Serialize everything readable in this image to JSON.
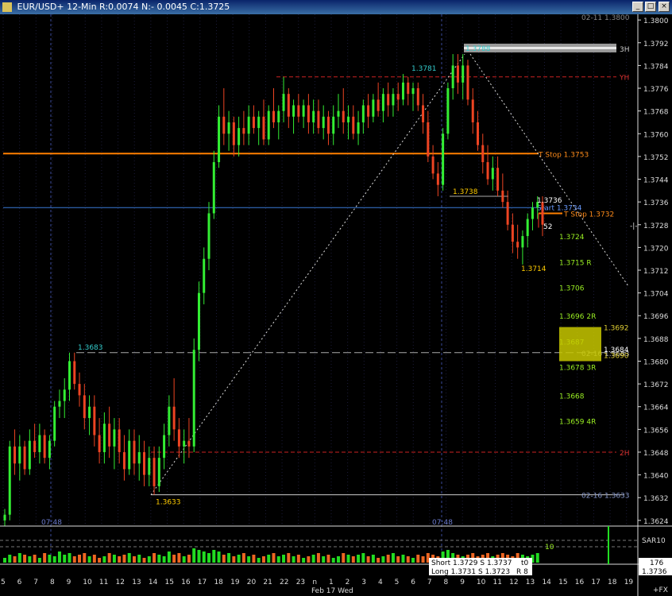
{
  "window": {
    "title": "EUR/USD+ 12-Min R:0.0074 N:- 0.0045 C:1.3725"
  },
  "chart_data": {
    "type": "candlestick",
    "symbol": "EUR/USD+",
    "interval": "12-Min",
    "header_stats": {
      "R": "0.0074",
      "N": "- 0.0045",
      "C": "1.3725"
    },
    "ylim": [
      1.3622,
      1.3802
    ],
    "y_ticks": [
      "1.3800",
      "1.3792",
      "1.3784",
      "1.3776",
      "1.3768",
      "1.3760",
      "1.3752",
      "1.3744",
      "1.3736",
      "1.3728",
      "1.3720",
      "1.3712",
      "1.3704",
      "1.3696",
      "1.3688",
      "1.3680",
      "1.3672",
      "1.3664",
      "1.3656",
      "1.3648",
      "1.3640",
      "1.3632",
      "1.3624"
    ],
    "x_ticks": [
      "5",
      "6",
      "7",
      "8",
      "9",
      "10",
      "11",
      "12",
      "13",
      "14",
      "15",
      "16",
      "17",
      "18",
      "19",
      "20",
      "21",
      "22",
      "23",
      "n",
      "1",
      "2",
      "3",
      "4",
      "5",
      "6",
      "7",
      "8",
      "9",
      "10",
      "11",
      "12",
      "13",
      "14",
      "15",
      "16",
      "17",
      "18",
      "19"
    ],
    "x_label": "Feb 17 Wed",
    "session_labels": [
      "07:48",
      "07:48"
    ],
    "top_right_label": "02-11  1.3800",
    "levels": [
      {
        "name": "3H",
        "price": 1.379,
        "color": "#bbbbbb",
        "text": "3H"
      },
      {
        "name": "YH",
        "price": 1.378,
        "color": "#cc2222",
        "text": "YH"
      },
      {
        "name": "T Stop",
        "price": 1.3753,
        "color": "#ff8000",
        "text": "T Stop  1.3753"
      },
      {
        "name": "Start",
        "price": 1.3734,
        "color": "#3a7bd5",
        "text": "Start  1.3734"
      },
      {
        "name": "T Stop 2",
        "price": 1.3732,
        "color": "#ff8000",
        "text": "T Stop  1.3732"
      },
      {
        "name": "02-16",
        "price": 1.3683,
        "color": "#aaaaaa",
        "text": "02-16  1.3683"
      },
      {
        "name": "2H",
        "price": 1.3648,
        "color": "#cc2222",
        "text": "2H"
      },
      {
        "name": "02-16 low",
        "price": 1.3633,
        "color": "#bbbbbb",
        "text": "02-16  1.3633"
      }
    ],
    "price_labels": [
      {
        "text": "1.3788",
        "price": 1.3788,
        "color": "#33cccc"
      },
      {
        "text": "1.3781",
        "price": 1.3781,
        "color": "#33cccc"
      },
      {
        "text": "1.3738",
        "price": 1.3738,
        "color": "#ffcc00"
      },
      {
        "text": "1.3736",
        "price": 1.3736,
        "color": "#ffffff"
      },
      {
        "text": "52",
        "price": 1.3729,
        "color": "#ffffff"
      },
      {
        "text": "1.3714",
        "price": 1.3714,
        "color": "#ffcc00"
      },
      {
        "text": "1.3683",
        "price": 1.3683,
        "color": "#33cccc"
      },
      {
        "text": "1.3633",
        "price": 1.3633,
        "color": "#ffcc00"
      }
    ],
    "target_labels": [
      {
        "text": "1.3724",
        "price": 1.3724
      },
      {
        "text": "1.3715  R",
        "price": 1.3715
      },
      {
        "text": "1.3706",
        "price": 1.3706
      },
      {
        "text": "1.3696  2R",
        "price": 1.3696
      },
      {
        "text": "1.3687",
        "price": 1.3687
      },
      {
        "text": "1.3678  3R",
        "price": 1.3678
      },
      {
        "text": "1.3668",
        "price": 1.3668
      },
      {
        "text": "1.3659  4R",
        "price": 1.3659
      }
    ],
    "zone": {
      "high_text": "1.3692",
      "low_text": "1.3690",
      "label": "1.3684"
    },
    "indicator": {
      "name": "SAR10",
      "value_label": "10"
    },
    "orders": {
      "short": "Short 1.3729  S 1.3737",
      "long": "Long  1.3731  S 1.3723",
      "t": "t0",
      "r": "R 8"
    },
    "bottom_box": {
      "count": "176",
      "price": "1.3736"
    },
    "corner_label": "+FX",
    "candles": [
      {
        "o": 1.3624,
        "h": 1.3628,
        "l": 1.3622,
        "c": 1.3626
      },
      {
        "o": 1.3626,
        "h": 1.3652,
        "l": 1.3624,
        "c": 1.365
      },
      {
        "o": 1.365,
        "h": 1.3656,
        "l": 1.364,
        "c": 1.3644
      },
      {
        "o": 1.3644,
        "h": 1.3654,
        "l": 1.3638,
        "c": 1.365
      },
      {
        "o": 1.365,
        "h": 1.3652,
        "l": 1.364,
        "c": 1.3642
      },
      {
        "o": 1.3642,
        "h": 1.3656,
        "l": 1.364,
        "c": 1.3652
      },
      {
        "o": 1.3652,
        "h": 1.3658,
        "l": 1.3646,
        "c": 1.3648
      },
      {
        "o": 1.3648,
        "h": 1.3658,
        "l": 1.3644,
        "c": 1.3654
      },
      {
        "o": 1.3654,
        "h": 1.3656,
        "l": 1.3644,
        "c": 1.3646
      },
      {
        "o": 1.3646,
        "h": 1.3654,
        "l": 1.3642,
        "c": 1.3652
      },
      {
        "o": 1.3652,
        "h": 1.3666,
        "l": 1.365,
        "c": 1.3664
      },
      {
        "o": 1.3664,
        "h": 1.367,
        "l": 1.366,
        "c": 1.3666
      },
      {
        "o": 1.3666,
        "h": 1.3674,
        "l": 1.366,
        "c": 1.367
      },
      {
        "o": 1.367,
        "h": 1.3683,
        "l": 1.3666,
        "c": 1.368
      },
      {
        "o": 1.368,
        "h": 1.3683,
        "l": 1.367,
        "c": 1.3672
      },
      {
        "o": 1.3672,
        "h": 1.3676,
        "l": 1.3664,
        "c": 1.3668
      },
      {
        "o": 1.3668,
        "h": 1.3672,
        "l": 1.3656,
        "c": 1.366
      },
      {
        "o": 1.366,
        "h": 1.3668,
        "l": 1.3654,
        "c": 1.3664
      },
      {
        "o": 1.3664,
        "h": 1.3668,
        "l": 1.365,
        "c": 1.3654
      },
      {
        "o": 1.3654,
        "h": 1.366,
        "l": 1.3644,
        "c": 1.3648
      },
      {
        "o": 1.3648,
        "h": 1.3662,
        "l": 1.3644,
        "c": 1.3658
      },
      {
        "o": 1.3658,
        "h": 1.3664,
        "l": 1.3646,
        "c": 1.365
      },
      {
        "o": 1.365,
        "h": 1.366,
        "l": 1.3642,
        "c": 1.3656
      },
      {
        "o": 1.3656,
        "h": 1.366,
        "l": 1.3644,
        "c": 1.3648
      },
      {
        "o": 1.3648,
        "h": 1.3654,
        "l": 1.3638,
        "c": 1.3642
      },
      {
        "o": 1.3642,
        "h": 1.3656,
        "l": 1.364,
        "c": 1.3652
      },
      {
        "o": 1.3652,
        "h": 1.3656,
        "l": 1.364,
        "c": 1.3644
      },
      {
        "o": 1.3644,
        "h": 1.3654,
        "l": 1.3638,
        "c": 1.3648
      },
      {
        "o": 1.3648,
        "h": 1.3652,
        "l": 1.3636,
        "c": 1.364
      },
      {
        "o": 1.364,
        "h": 1.365,
        "l": 1.3636,
        "c": 1.3646
      },
      {
        "o": 1.3646,
        "h": 1.365,
        "l": 1.3633,
        "c": 1.3636
      },
      {
        "o": 1.3636,
        "h": 1.365,
        "l": 1.3634,
        "c": 1.3646
      },
      {
        "o": 1.3646,
        "h": 1.3658,
        "l": 1.3642,
        "c": 1.3654
      },
      {
        "o": 1.3654,
        "h": 1.3668,
        "l": 1.365,
        "c": 1.3664
      },
      {
        "o": 1.3664,
        "h": 1.3674,
        "l": 1.3652,
        "c": 1.3656
      },
      {
        "o": 1.3656,
        "h": 1.366,
        "l": 1.3646,
        "c": 1.365
      },
      {
        "o": 1.365,
        "h": 1.3656,
        "l": 1.3644,
        "c": 1.3652
      },
      {
        "o": 1.3652,
        "h": 1.366,
        "l": 1.3646,
        "c": 1.365
      },
      {
        "o": 1.365,
        "h": 1.3688,
        "l": 1.3648,
        "c": 1.3684
      },
      {
        "o": 1.3684,
        "h": 1.3708,
        "l": 1.368,
        "c": 1.3704
      },
      {
        "o": 1.3704,
        "h": 1.372,
        "l": 1.37,
        "c": 1.3716
      },
      {
        "o": 1.3716,
        "h": 1.3736,
        "l": 1.3712,
        "c": 1.3732
      },
      {
        "o": 1.3732,
        "h": 1.3754,
        "l": 1.373,
        "c": 1.375
      },
      {
        "o": 1.375,
        "h": 1.377,
        "l": 1.3748,
        "c": 1.3766
      },
      {
        "o": 1.3766,
        "h": 1.3776,
        "l": 1.3756,
        "c": 1.376
      },
      {
        "o": 1.376,
        "h": 1.3768,
        "l": 1.3754,
        "c": 1.3764
      },
      {
        "o": 1.3764,
        "h": 1.3766,
        "l": 1.3752,
        "c": 1.3756
      },
      {
        "o": 1.3756,
        "h": 1.3766,
        "l": 1.3752,
        "c": 1.3762
      },
      {
        "o": 1.3762,
        "h": 1.3768,
        "l": 1.3756,
        "c": 1.376
      },
      {
        "o": 1.376,
        "h": 1.377,
        "l": 1.3756,
        "c": 1.3766
      },
      {
        "o": 1.3766,
        "h": 1.377,
        "l": 1.376,
        "c": 1.3762
      },
      {
        "o": 1.3762,
        "h": 1.3768,
        "l": 1.3756,
        "c": 1.3766
      },
      {
        "o": 1.3766,
        "h": 1.3772,
        "l": 1.3756,
        "c": 1.3758
      },
      {
        "o": 1.3758,
        "h": 1.377,
        "l": 1.3756,
        "c": 1.3768
      },
      {
        "o": 1.3768,
        "h": 1.3776,
        "l": 1.3762,
        "c": 1.3764
      },
      {
        "o": 1.3764,
        "h": 1.377,
        "l": 1.3758,
        "c": 1.3768
      },
      {
        "o": 1.3768,
        "h": 1.378,
        "l": 1.3764,
        "c": 1.3774
      },
      {
        "o": 1.3774,
        "h": 1.3776,
        "l": 1.3762,
        "c": 1.3766
      },
      {
        "o": 1.3766,
        "h": 1.3772,
        "l": 1.376,
        "c": 1.377
      },
      {
        "o": 1.377,
        "h": 1.3774,
        "l": 1.3764,
        "c": 1.3766
      },
      {
        "o": 1.3766,
        "h": 1.3772,
        "l": 1.3762,
        "c": 1.377
      },
      {
        "o": 1.377,
        "h": 1.3774,
        "l": 1.376,
        "c": 1.3764
      },
      {
        "o": 1.3764,
        "h": 1.3772,
        "l": 1.376,
        "c": 1.3768
      },
      {
        "o": 1.3768,
        "h": 1.3772,
        "l": 1.376,
        "c": 1.3762
      },
      {
        "o": 1.3762,
        "h": 1.377,
        "l": 1.3758,
        "c": 1.3766
      },
      {
        "o": 1.3766,
        "h": 1.3768,
        "l": 1.3756,
        "c": 1.376
      },
      {
        "o": 1.376,
        "h": 1.377,
        "l": 1.3756,
        "c": 1.3766
      },
      {
        "o": 1.3766,
        "h": 1.3774,
        "l": 1.3762,
        "c": 1.3768
      },
      {
        "o": 1.3768,
        "h": 1.3776,
        "l": 1.376,
        "c": 1.3764
      },
      {
        "o": 1.3764,
        "h": 1.377,
        "l": 1.3758,
        "c": 1.3766
      },
      {
        "o": 1.3766,
        "h": 1.377,
        "l": 1.3758,
        "c": 1.376
      },
      {
        "o": 1.376,
        "h": 1.3768,
        "l": 1.3756,
        "c": 1.3764
      },
      {
        "o": 1.3764,
        "h": 1.3772,
        "l": 1.376,
        "c": 1.377
      },
      {
        "o": 1.377,
        "h": 1.3774,
        "l": 1.3762,
        "c": 1.3766
      },
      {
        "o": 1.3766,
        "h": 1.3774,
        "l": 1.3764,
        "c": 1.3772
      },
      {
        "o": 1.3772,
        "h": 1.3778,
        "l": 1.3766,
        "c": 1.3768
      },
      {
        "o": 1.3768,
        "h": 1.3776,
        "l": 1.3764,
        "c": 1.3774
      },
      {
        "o": 1.3774,
        "h": 1.3778,
        "l": 1.3766,
        "c": 1.377
      },
      {
        "o": 1.377,
        "h": 1.3776,
        "l": 1.3766,
        "c": 1.3774
      },
      {
        "o": 1.3774,
        "h": 1.3778,
        "l": 1.3768,
        "c": 1.3772
      },
      {
        "o": 1.3772,
        "h": 1.3781,
        "l": 1.377,
        "c": 1.3778
      },
      {
        "o": 1.3778,
        "h": 1.378,
        "l": 1.377,
        "c": 1.3774
      },
      {
        "o": 1.3774,
        "h": 1.3778,
        "l": 1.3768,
        "c": 1.3776
      },
      {
        "o": 1.3776,
        "h": 1.3778,
        "l": 1.3768,
        "c": 1.377
      },
      {
        "o": 1.377,
        "h": 1.3774,
        "l": 1.376,
        "c": 1.3764
      },
      {
        "o": 1.3764,
        "h": 1.3768,
        "l": 1.375,
        "c": 1.3752
      },
      {
        "o": 1.3752,
        "h": 1.3756,
        "l": 1.3744,
        "c": 1.3746
      },
      {
        "o": 1.3746,
        "h": 1.375,
        "l": 1.3738,
        "c": 1.3742
      },
      {
        "o": 1.3742,
        "h": 1.3762,
        "l": 1.374,
        "c": 1.376
      },
      {
        "o": 1.376,
        "h": 1.3778,
        "l": 1.3758,
        "c": 1.3776
      },
      {
        "o": 1.3776,
        "h": 1.3788,
        "l": 1.3772,
        "c": 1.3784
      },
      {
        "o": 1.3784,
        "h": 1.3788,
        "l": 1.3774,
        "c": 1.3778
      },
      {
        "o": 1.3778,
        "h": 1.3788,
        "l": 1.3772,
        "c": 1.3784
      },
      {
        "o": 1.3784,
        "h": 1.3786,
        "l": 1.377,
        "c": 1.3772
      },
      {
        "o": 1.3772,
        "h": 1.3776,
        "l": 1.376,
        "c": 1.3764
      },
      {
        "o": 1.3764,
        "h": 1.3768,
        "l": 1.3754,
        "c": 1.3756
      },
      {
        "o": 1.3756,
        "h": 1.376,
        "l": 1.3746,
        "c": 1.375
      },
      {
        "o": 1.375,
        "h": 1.3756,
        "l": 1.3742,
        "c": 1.3744
      },
      {
        "o": 1.3744,
        "h": 1.3752,
        "l": 1.374,
        "c": 1.3748
      },
      {
        "o": 1.3748,
        "h": 1.3752,
        "l": 1.3738,
        "c": 1.374
      },
      {
        "o": 1.374,
        "h": 1.3746,
        "l": 1.3734,
        "c": 1.3736
      },
      {
        "o": 1.3736,
        "h": 1.374,
        "l": 1.3726,
        "c": 1.3728
      },
      {
        "o": 1.3728,
        "h": 1.3732,
        "l": 1.3718,
        "c": 1.3722
      },
      {
        "o": 1.3722,
        "h": 1.3728,
        "l": 1.3716,
        "c": 1.372
      },
      {
        "o": 1.372,
        "h": 1.3726,
        "l": 1.3714,
        "c": 1.3724
      },
      {
        "o": 1.3724,
        "h": 1.3732,
        "l": 1.372,
        "c": 1.373
      },
      {
        "o": 1.373,
        "h": 1.3736,
        "l": 1.3726,
        "c": 1.3734
      },
      {
        "o": 1.3734,
        "h": 1.3738,
        "l": 1.373,
        "c": 1.3736
      },
      {
        "o": 1.3736,
        "h": 1.3738,
        "l": 1.3724,
        "c": 1.3728
      }
    ],
    "volumes": [
      3,
      5,
      4,
      6,
      5,
      4,
      5,
      3,
      6,
      5,
      4,
      7,
      5,
      6,
      4,
      5,
      6,
      4,
      5,
      3,
      4,
      6,
      5,
      4,
      5,
      6,
      4,
      5,
      3,
      4,
      6,
      5,
      4,
      7,
      5,
      6,
      4,
      5,
      9,
      8,
      7,
      6,
      8,
      7,
      5,
      6,
      4,
      5,
      6,
      4,
      5,
      3,
      4,
      5,
      6,
      4,
      5,
      6,
      4,
      5,
      3,
      4,
      5,
      6,
      4,
      5,
      3,
      4,
      6,
      5,
      4,
      5,
      6,
      4,
      5,
      3,
      4,
      5,
      6,
      4,
      5,
      4,
      3,
      5,
      4,
      6,
      5,
      4,
      7,
      8,
      6,
      5,
      4,
      5,
      6,
      4,
      5,
      6,
      4,
      5,
      6,
      5,
      4,
      6,
      5,
      4,
      5,
      6
    ]
  }
}
